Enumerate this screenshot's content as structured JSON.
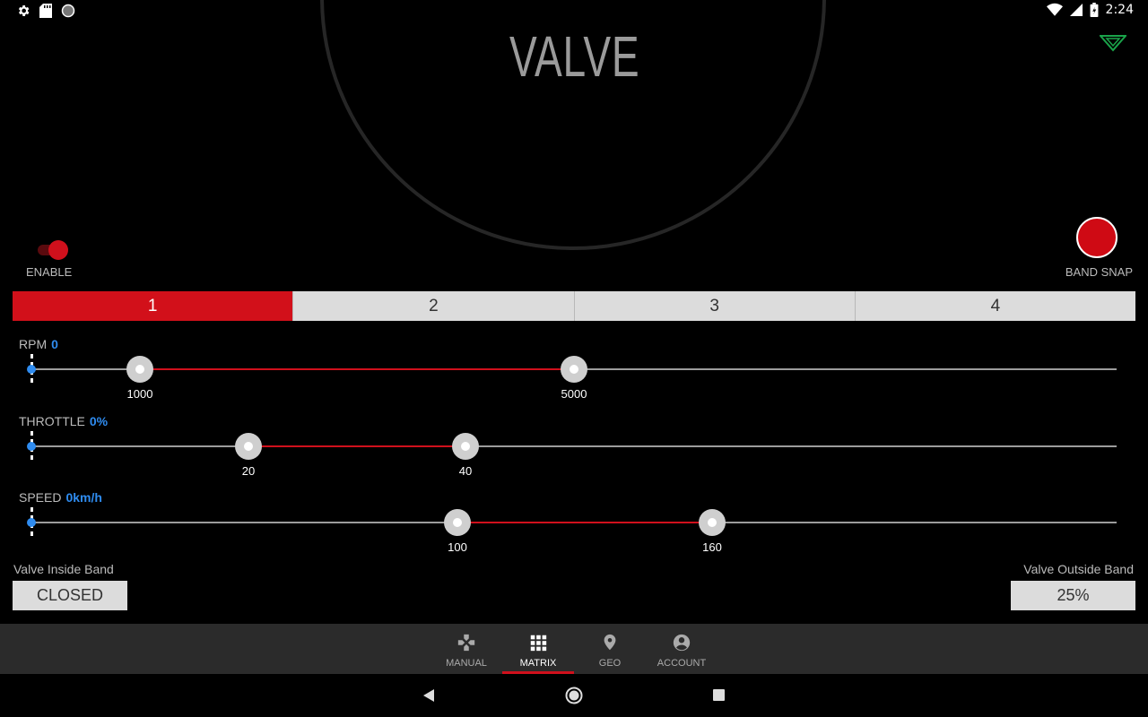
{
  "status_bar": {
    "time": "2:24",
    "icons": [
      "gear-icon",
      "sd-card-icon",
      "circle-icon",
      "wifi-icon",
      "signal-icon",
      "battery-icon"
    ]
  },
  "gauge": {
    "title": "VALVE"
  },
  "enable": {
    "label": "ENABLE",
    "on": true
  },
  "band_snap": {
    "label": "BAND SNAP"
  },
  "band_tabs": [
    {
      "label": "1",
      "active": true
    },
    {
      "label": "2",
      "active": false
    },
    {
      "label": "3",
      "active": false
    },
    {
      "label": "4",
      "active": false
    }
  ],
  "sliders": {
    "rpm": {
      "label": "RPM",
      "value": "0",
      "low": "1000",
      "high": "5000"
    },
    "throttle": {
      "label": "THROTTLE",
      "value": "0%",
      "low": "20",
      "high": "40"
    },
    "speed": {
      "label": "SPEED",
      "value": "0km/h",
      "low": "100",
      "high": "160"
    }
  },
  "valve_inside": {
    "label": "Valve Inside Band",
    "value": "CLOSED"
  },
  "valve_outside": {
    "label": "Valve Outside Band",
    "value": "25%"
  },
  "bottom_nav": [
    {
      "label": "MANUAL",
      "icon": "gamepad-icon",
      "active": false
    },
    {
      "label": "MATRIX",
      "icon": "grid-icon",
      "active": true
    },
    {
      "label": "GEO",
      "icon": "location-pin-icon",
      "active": false
    },
    {
      "label": "ACCOUNT",
      "icon": "account-circle-icon",
      "active": false
    }
  ],
  "colors": {
    "accent": "#d0101c",
    "value_blue": "#2f8cf0",
    "background": "#000000",
    "logo_green": "#1aa34a"
  }
}
